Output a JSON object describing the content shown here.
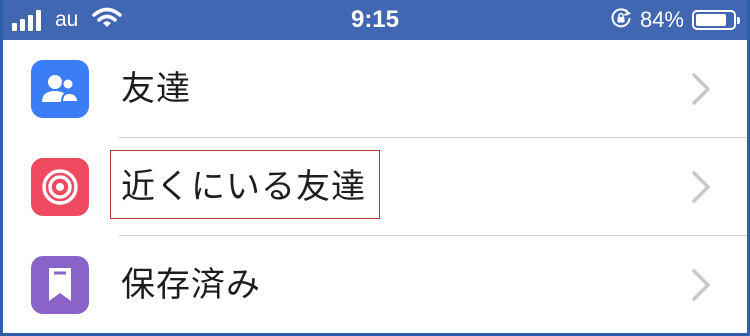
{
  "status_bar": {
    "carrier": "au",
    "time": "9:15",
    "battery_percent": "84%",
    "battery_level": 0.84,
    "icons": [
      "signal-icon",
      "wifi-icon",
      "rotation-lock-icon",
      "battery-icon"
    ]
  },
  "menu": {
    "items": [
      {
        "label": "友達",
        "icon": "friends-icon",
        "color": "#3b7df6"
      },
      {
        "label": "近くにいる友達",
        "icon": "nearby-target-icon",
        "color": "#ef4a62"
      },
      {
        "label": "保存済み",
        "icon": "bookmark-icon",
        "color": "#8a63c9"
      }
    ]
  },
  "colors": {
    "status_bar": "#4267b2",
    "chevron": "#c7c7cc",
    "highlight_box": "#b23a3a"
  }
}
